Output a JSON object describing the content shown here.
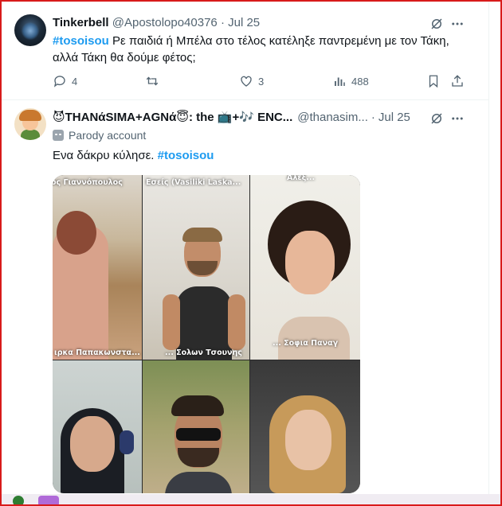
{
  "tweet1": {
    "author_name": "Tinkerbell",
    "handle": "@Apostolopo40376",
    "separator": "·",
    "date": "Jul 25",
    "hashtag": "#tosoisou",
    "text": " Ρε παιδιά ή Μπέλα στο τέλος κατέληξε παντρεμένη με τον Τάκη, αλλά Τάκη θα δούμε φέτος;",
    "replies": "4",
    "retweets": "",
    "likes": "3",
    "views": "488"
  },
  "tweet2": {
    "author_name": "😈THANάSIMA+AGNά😇: the 📺+🎶 ENC...",
    "handle": "@thanasim...",
    "separator": "·",
    "date": "Jul 25",
    "parody_label": "Parody account",
    "text": "Ενα δάκρυ κύλησε. ",
    "hashtag": "#tosoisou",
    "media": {
      "label_top_left": "ος Γιαννόπουλος",
      "label_top_mid": "Εσείς (Vasiliki Laska...",
      "label_top_right": "Αλεξ...",
      "label_left_bottom": "ιρκα Παπακωνστα...",
      "label_center": "... Σολων Τσουνης",
      "label_right": "... Σοφια Παναγ"
    }
  },
  "icons": [
    "grok-icon",
    "more-icon",
    "reply-icon",
    "retweet-icon",
    "like-icon",
    "views-icon",
    "bookmark-icon",
    "share-icon"
  ]
}
